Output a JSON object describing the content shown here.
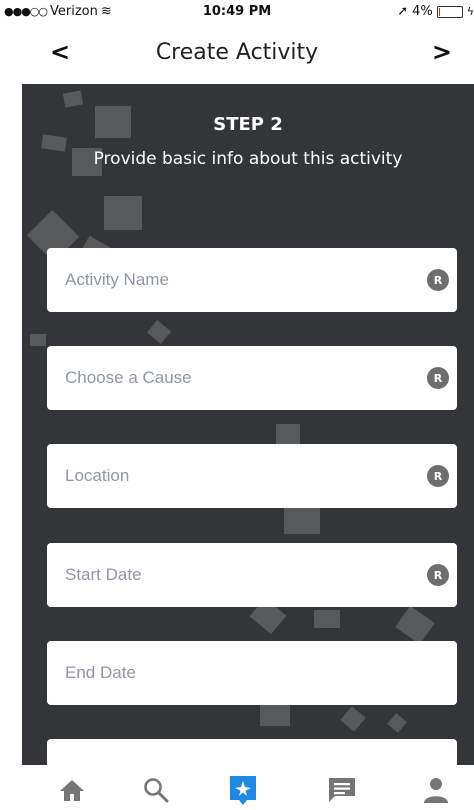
{
  "status_bar": {
    "signal": "●●●○○",
    "carrier": "Verizon",
    "wifi_glyph": "≋",
    "time": "10:49 PM",
    "location_glyph": "➚",
    "battery_text": "4%",
    "battery_level": 0.04,
    "charging_glyph": "ϟ"
  },
  "nav": {
    "back_glyph": "<",
    "title": "Create Activity",
    "next_glyph": ">"
  },
  "step": {
    "title": "STEP 2",
    "subtitle": "Provide basic info about this activity"
  },
  "fields": [
    {
      "label": "Activity Name",
      "required_badge": "R"
    },
    {
      "label": "Choose a Cause",
      "required_badge": "R"
    },
    {
      "label": "Location",
      "required_badge": "R"
    },
    {
      "label": "Start Date",
      "required_badge": "R"
    },
    {
      "label": "End Date"
    }
  ],
  "tabs": [
    {
      "icon": "home-icon"
    },
    {
      "icon": "search-icon"
    },
    {
      "icon": "create-activity-icon",
      "active": true
    },
    {
      "icon": "messages-icon"
    },
    {
      "icon": "profile-icon"
    }
  ],
  "colors": {
    "panel_bg": "#333538",
    "placeholder": "#9097a3",
    "active_tab": "#1e88e5",
    "inactive_tab": "#757575",
    "battery_low": "#e0201b"
  }
}
